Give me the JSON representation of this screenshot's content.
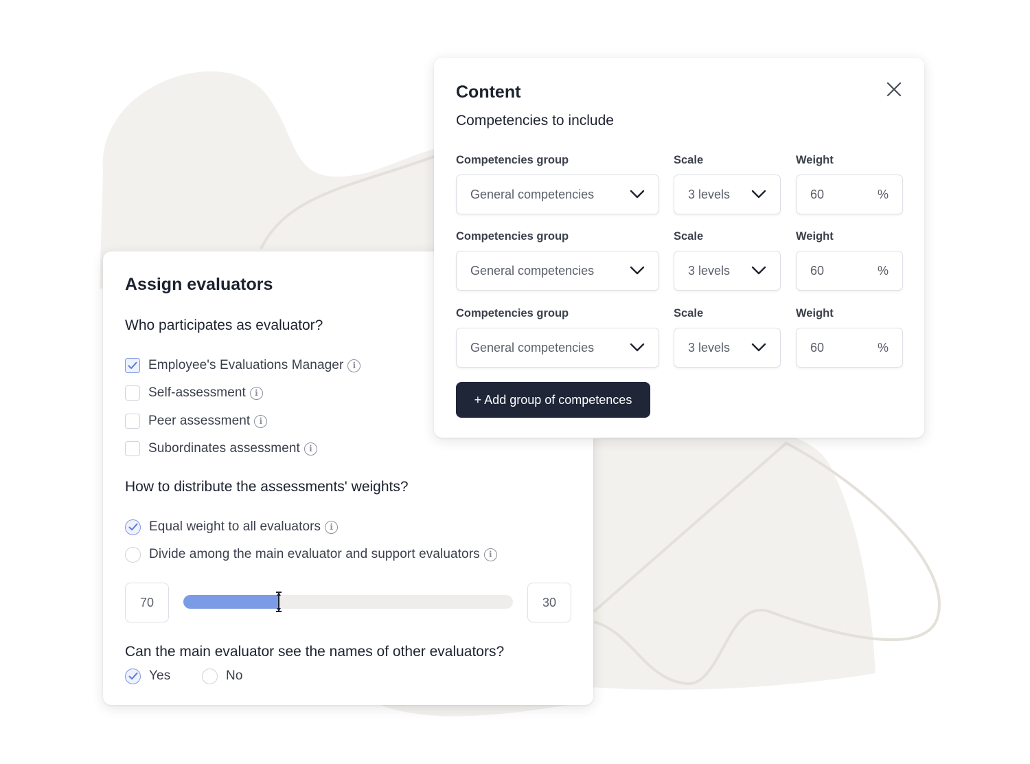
{
  "assign": {
    "title": "Assign evaluators",
    "question_participants": "Who participates as evaluator?",
    "participants": [
      {
        "label": "Employee's Evaluations Manager",
        "checked": true
      },
      {
        "label": "Self-assessment",
        "checked": false
      },
      {
        "label": "Peer assessment",
        "checked": false
      },
      {
        "label": "Subordinates assessment",
        "checked": false
      }
    ],
    "question_weights": "How to distribute the assessments' weights?",
    "weight_options": [
      {
        "label": "Equal weight to all evaluators",
        "selected": true
      },
      {
        "label": "Divide among the main evaluator and support evaluators",
        "selected": false
      }
    ],
    "slider": {
      "left_value": "70",
      "right_value": "30",
      "fill_fraction": 0.29
    },
    "question_names": "Can the main evaluator see the names of other evaluators?",
    "names_options": [
      {
        "label": "Yes",
        "selected": true
      },
      {
        "label": "No",
        "selected": false
      }
    ]
  },
  "content": {
    "title": "Content",
    "subtitle": "Competencies to include",
    "labels": {
      "group": "Competencies group",
      "scale": "Scale",
      "weight": "Weight"
    },
    "rows": [
      {
        "group": "General competencies",
        "scale": "3 levels",
        "weight": "60",
        "unit": "%"
      },
      {
        "group": "General competencies",
        "scale": "3 levels",
        "weight": "60",
        "unit": "%"
      },
      {
        "group": "General competencies",
        "scale": "3 levels",
        "weight": "60",
        "unit": "%"
      }
    ],
    "add_button": "+ Add group of competences"
  },
  "icons": {
    "close": "close-icon",
    "chevron": "chevron-down-icon",
    "info": "info-icon",
    "check": "check-icon"
  },
  "colors": {
    "accent": "#7c9be6",
    "button_dark": "#1e2638",
    "background_blob": "#f3f1ee"
  }
}
